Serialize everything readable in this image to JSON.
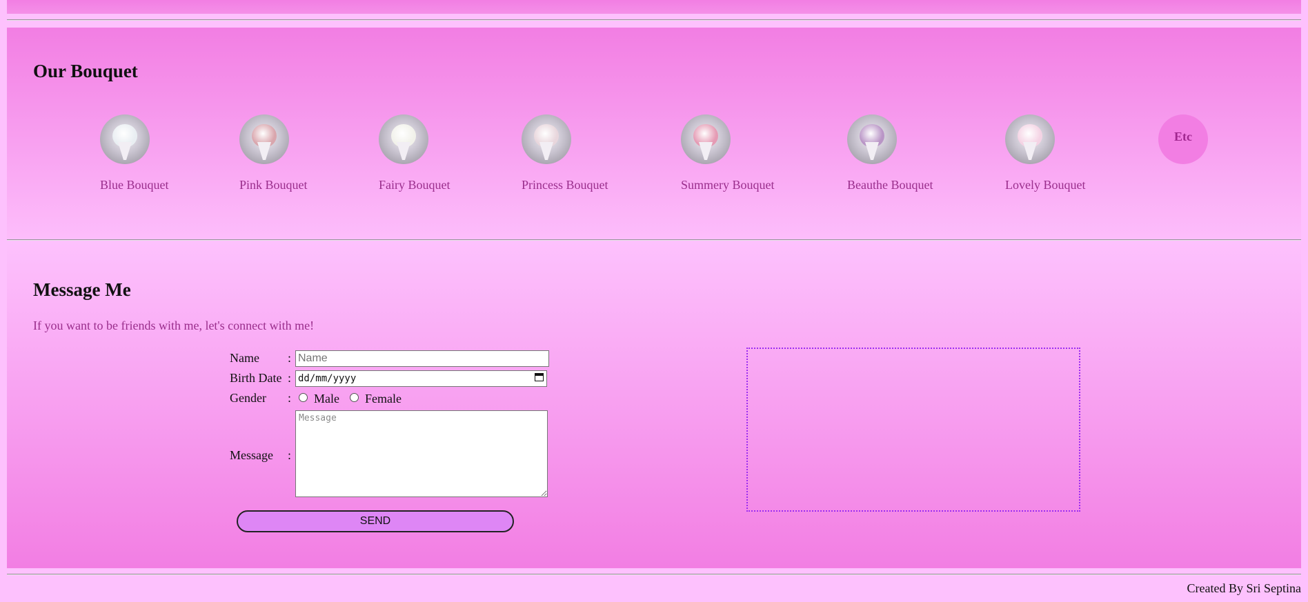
{
  "bouquet_section": {
    "title": "Our Bouquet",
    "items": [
      {
        "label": "Blue Bouquet",
        "bloom_color": "#e9eef2"
      },
      {
        "label": "Pink Bouquet",
        "bloom_color": "#d9a6ad"
      },
      {
        "label": "Fairy Bouquet",
        "bloom_color": "#f1f1ea"
      },
      {
        "label": "Princess Bouquet",
        "bloom_color": "#e8d6dc"
      },
      {
        "label": "Summery Bouquet",
        "bloom_color": "#e59bb4"
      },
      {
        "label": "Beauthe Bouquet",
        "bloom_color": "#b995c6"
      },
      {
        "label": "Lovely Bouquet",
        "bloom_color": "#f4d3e4"
      }
    ],
    "etc_label": "Etc"
  },
  "message_section": {
    "title": "Message Me",
    "intro": "If you want to be friends with me, let's connect with me!",
    "form": {
      "name_label": "Name",
      "name_placeholder": "Name",
      "birth_label": "Birth Date",
      "birth_placeholder": "dd/mm/yyyy",
      "gender_label": "Gender",
      "gender_options": [
        "Male",
        "Female"
      ],
      "message_label": "Message",
      "message_placeholder": "Message",
      "colon": ":",
      "send_label": "SEND"
    }
  },
  "footer": {
    "credit": "Created By Sri Septina"
  },
  "colors": {
    "accent_pink": "#f27ee3",
    "light_pink": "#fdc1fd",
    "label_text": "#9a2e8c",
    "send_button": "#de86f5",
    "map_border": "#9b2cf0"
  }
}
